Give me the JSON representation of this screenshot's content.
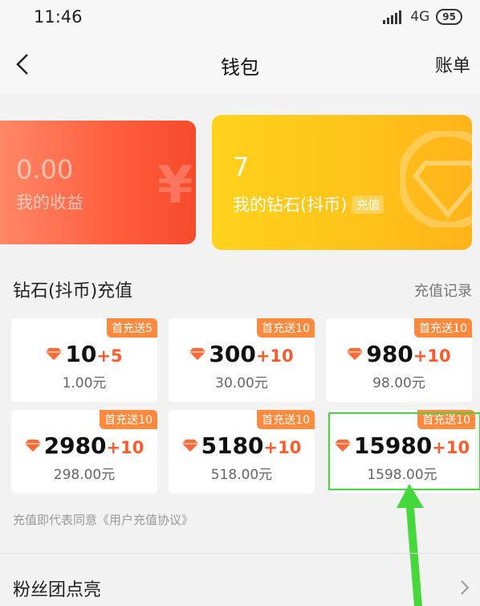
{
  "status_bar": {
    "time": "11:46",
    "network": "4G",
    "battery": "95"
  },
  "header": {
    "title": "钱包",
    "right_link": "账单"
  },
  "cards": {
    "income": {
      "amount": "0.00",
      "label": "我的收益",
      "bg_watermark": "¥"
    },
    "diamonds": {
      "amount": "7",
      "label": "我的钻石(抖币)",
      "tag": "充值"
    }
  },
  "recharge": {
    "title": "钻石(抖币)充值",
    "records_link": "充值记录",
    "packages": [
      {
        "badge": "首充送5",
        "coins": "10",
        "bonus": "+5",
        "price": "1.00元"
      },
      {
        "badge": "首充送10",
        "coins": "300",
        "bonus": "+10",
        "price": "30.00元"
      },
      {
        "badge": "首充送10",
        "coins": "980",
        "bonus": "+10",
        "price": "98.00元"
      },
      {
        "badge": "首充送10",
        "coins": "2980",
        "bonus": "+10",
        "price": "298.00元"
      },
      {
        "badge": "首充送10",
        "coins": "5180",
        "bonus": "+10",
        "price": "518.00元"
      },
      {
        "badge": "首充送10",
        "coins": "15980",
        "bonus": "+10",
        "price": "1598.00元"
      }
    ],
    "agreement": "充值即代表同意《用户充值协议》"
  },
  "fan_club": {
    "label": "粉丝团点亮"
  },
  "colors": {
    "accent_orange": "#ff5a2c",
    "badge_orange": "#ff8a3d",
    "highlight_green": "#45d83a"
  },
  "icons": [
    "back-icon",
    "gem-icon",
    "diamond-watermark-icon",
    "chevron-right-icon",
    "arrow-annotation"
  ]
}
